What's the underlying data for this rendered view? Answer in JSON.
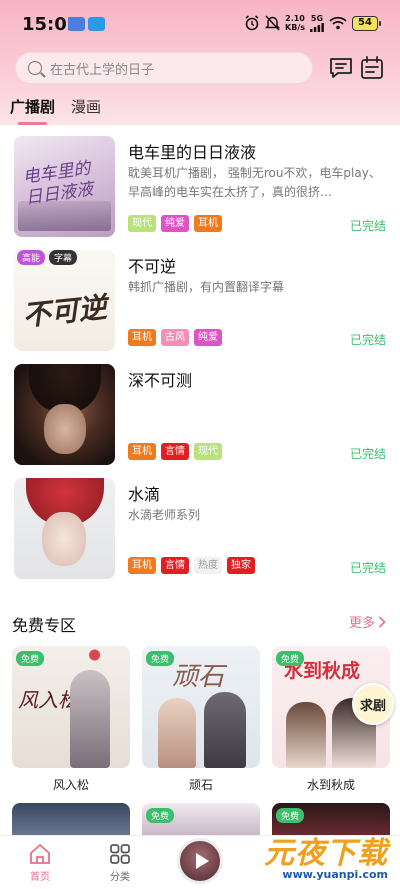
{
  "status_bar": {
    "time": "15:02",
    "speed_value": "2.10",
    "speed_unit": "KB/s",
    "network": "5G",
    "battery": "54"
  },
  "search": {
    "placeholder": "在古代上学的日子"
  },
  "tabs": [
    {
      "label": "广播剧",
      "active": true
    },
    {
      "label": "漫画",
      "active": false
    }
  ],
  "dramas": [
    {
      "title": "电车里的日日液液",
      "cover_text": "电车里的日日液液",
      "description": "耽美耳机广播剧， 强制无rou不欢，电车play、 早高峰的电车实在太挤了，真的很挤…",
      "tags": [
        {
          "label": "现代",
          "color": "#b7e37a"
        },
        {
          "label": "纯爱",
          "color": "#e052c6"
        },
        {
          "label": "耳机",
          "color": "#f07a1e"
        }
      ],
      "status": "已完结"
    },
    {
      "title": "不可逆",
      "cover_text": "不可逆",
      "badges": [
        {
          "label": "高能",
          "color": "#c054d8"
        },
        {
          "label": "字幕",
          "color": "#333333"
        }
      ],
      "description": "韩抓广播剧，有内置翻译字幕",
      "tags": [
        {
          "label": "耳机",
          "color": "#f07a1e"
        },
        {
          "label": "古风",
          "color": "#f490b8"
        },
        {
          "label": "纯爱",
          "color": "#e052c6"
        }
      ],
      "status": "已完结"
    },
    {
      "title": "深不可测",
      "description": "",
      "tags": [
        {
          "label": "耳机",
          "color": "#f07a1e"
        },
        {
          "label": "言情",
          "color": "#e01e24"
        },
        {
          "label": "现代",
          "color": "#b7e37a"
        }
      ],
      "status": "已完结"
    },
    {
      "title": "水滴",
      "description": "水滴老师系列",
      "tags": [
        {
          "label": "耳机",
          "color": "#f07a1e"
        },
        {
          "label": "言情",
          "color": "#e01e24"
        },
        {
          "label": "热度",
          "color": "#f2f2f2"
        },
        {
          "label": "独家",
          "color": "#e01e24"
        }
      ],
      "status": "已完结"
    }
  ],
  "free_section": {
    "title": "免费专区",
    "more_label": "更多",
    "badge": "免费",
    "cards": [
      {
        "title": "风入松",
        "cover_text": "风入松"
      },
      {
        "title": "顽石",
        "cover_text": "顽石"
      },
      {
        "title": "水到秋成",
        "cover_text": "水到秋成"
      }
    ]
  },
  "floating_button": "求剧",
  "bottom_nav": [
    {
      "label": "首页",
      "active": true
    },
    {
      "label": "分类",
      "active": false
    }
  ],
  "watermark": {
    "main": "元夜下载",
    "url": "www.yuanpi.com"
  },
  "colors": {
    "accent": "#e86e8c",
    "completed": "#3cbf6c",
    "header_pink": "#f8b5c4"
  }
}
